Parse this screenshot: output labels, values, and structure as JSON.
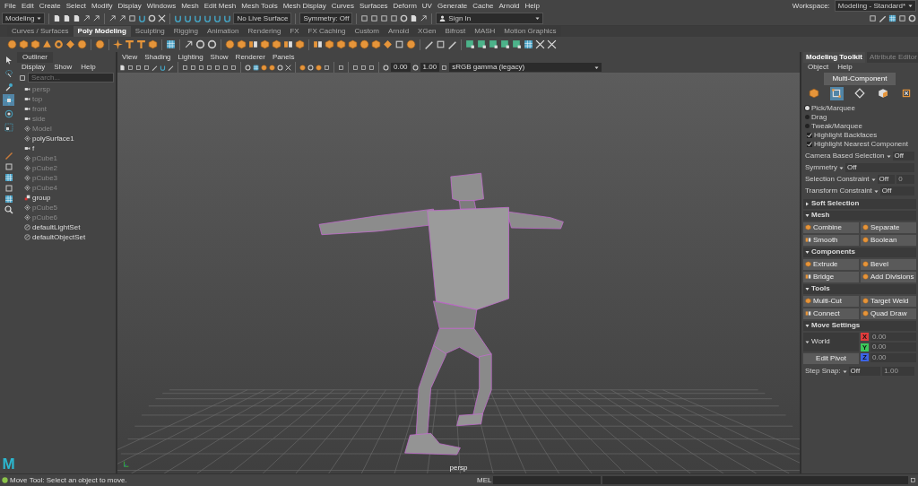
{
  "menu_bar": [
    "File",
    "Edit",
    "Create",
    "Select",
    "Modify",
    "Display",
    "Windows",
    "Mesh",
    "Edit Mesh",
    "Mesh Tools",
    "Mesh Display",
    "Curves",
    "Surfaces",
    "Deform",
    "UV",
    "Generate",
    "Cache",
    "Arnold",
    "Help"
  ],
  "workspace": {
    "label": "Workspace:",
    "value": "Modeling - Standard*"
  },
  "status_line": {
    "mode": "Modeling",
    "live_surface": "No Live Surface",
    "symmetry": "Symmetry: Off",
    "sign_in": "Sign In"
  },
  "shelf_tabs": [
    {
      "label": "Curves / Surfaces",
      "selected": false
    },
    {
      "label": "Poly Modeling",
      "selected": true
    },
    {
      "label": "Sculpting",
      "selected": false
    },
    {
      "label": "Rigging",
      "selected": false
    },
    {
      "label": "Animation",
      "selected": false
    },
    {
      "label": "Rendering",
      "selected": false
    },
    {
      "label": "FX",
      "selected": false
    },
    {
      "label": "FX Caching",
      "selected": false
    },
    {
      "label": "Custom",
      "selected": false
    },
    {
      "label": "Arnold",
      "selected": false
    },
    {
      "label": "XGen",
      "selected": false
    },
    {
      "label": "Bifrost",
      "selected": false
    },
    {
      "label": "MASH",
      "selected": false
    },
    {
      "label": "Motion Graphics",
      "selected": false
    }
  ],
  "toolbox": [
    {
      "kind": "select",
      "selected": false
    },
    {
      "kind": "lasso",
      "selected": false
    },
    {
      "kind": "paint",
      "selected": false
    },
    {
      "kind": "move",
      "selected": true
    },
    {
      "kind": "rotate",
      "selected": false
    },
    {
      "kind": "scale",
      "selected": false
    },
    {
      "kind": "last",
      "selected": false
    }
  ],
  "logo": "M",
  "outliner": {
    "title": "Outliner",
    "menu": [
      "Display",
      "Show",
      "Help"
    ],
    "search_placeholder": "Search...",
    "items": [
      {
        "label": "persp",
        "kind": "camera",
        "hidden": true
      },
      {
        "label": "top",
        "kind": "camera",
        "hidden": true
      },
      {
        "label": "front",
        "kind": "camera",
        "hidden": true
      },
      {
        "label": "side",
        "kind": "camera",
        "hidden": true
      },
      {
        "label": "Model",
        "kind": "transform",
        "hidden": true
      },
      {
        "label": "polySurface1",
        "kind": "transform",
        "hidden": false
      },
      {
        "label": "f",
        "kind": "camera",
        "hidden": false
      },
      {
        "label": "pCube1",
        "kind": "transform",
        "hidden": true
      },
      {
        "label": "pCube2",
        "kind": "transform",
        "hidden": true
      },
      {
        "label": "pCube3",
        "kind": "transform",
        "hidden": true
      },
      {
        "label": "pCube4",
        "kind": "transform",
        "hidden": true
      },
      {
        "label": "group",
        "kind": "group",
        "hidden": false
      },
      {
        "label": "pCube5",
        "kind": "transform",
        "hidden": true
      },
      {
        "label": "pCube6",
        "kind": "transform",
        "hidden": true
      },
      {
        "label": "defaultLightSet",
        "kind": "set",
        "hidden": false
      },
      {
        "label": "defaultObjectSet",
        "kind": "set",
        "hidden": false
      }
    ]
  },
  "viewport": {
    "menu": [
      "View",
      "Shading",
      "Lighting",
      "Show",
      "Renderer",
      "Panels"
    ],
    "exposure": "0.00",
    "gamma": "1.00",
    "color_space": "sRGB gamma (legacy)",
    "camera_label": "persp"
  },
  "toolkit": {
    "tabs": [
      {
        "label": "Modeling Toolkit",
        "selected": true
      },
      {
        "label": "Attribute Editor",
        "selected": false
      }
    ],
    "menu": [
      "Object",
      "Help"
    ],
    "multi_component": "Multi-Component",
    "components": [
      {
        "kind": "object",
        "selected": false
      },
      {
        "kind": "vertex",
        "selected": true
      },
      {
        "kind": "edge",
        "selected": false
      },
      {
        "kind": "face",
        "selected": false
      },
      {
        "kind": "uv",
        "selected": false
      }
    ],
    "selection_modes": [
      {
        "label": "Pick/Marquee",
        "selected": true
      },
      {
        "label": "Drag",
        "selected": false
      },
      {
        "label": "Tweak/Marquee",
        "selected": false
      }
    ],
    "options": [
      {
        "label": "Highlight Backfaces",
        "checked": true
      },
      {
        "label": "Highlight Nearest Component",
        "checked": true
      }
    ],
    "settings": [
      {
        "label": "Camera Based Selection",
        "value": "Off"
      },
      {
        "label": "Symmetry",
        "value": "Off"
      },
      {
        "label": "Selection Constraint",
        "value": "Off",
        "extra": "0"
      },
      {
        "label": "Transform Constraint",
        "value": "Off"
      }
    ],
    "sections": [
      {
        "title": "Soft Selection",
        "expanded": false
      },
      {
        "title": "Mesh",
        "expanded": true,
        "buttons": [
          "Combine",
          "Separate",
          "Smooth",
          "Boolean"
        ]
      },
      {
        "title": "Components",
        "expanded": true,
        "buttons": [
          "Extrude",
          "Bevel",
          "Bridge",
          "Add Divisions"
        ]
      },
      {
        "title": "Tools",
        "expanded": true,
        "buttons": [
          "Multi-Cut",
          "Target Weld",
          "Connect",
          "Quad Draw"
        ]
      }
    ],
    "move_settings": {
      "title": "Move Settings",
      "expanded": true,
      "space": "World",
      "axes": [
        {
          "axis": "X",
          "value": "0.00",
          "color": "#e03c3c"
        },
        {
          "axis": "Y",
          "value": "0.00",
          "color": "#3cc85a"
        },
        {
          "axis": "Z",
          "value": "0.00",
          "color": "#3c64e6"
        }
      ],
      "edit_pivot": "Edit Pivot",
      "step_snap_label": "Step Snap:",
      "step_snap": "Off",
      "step_value": "1.00"
    }
  },
  "command_line": {
    "message": "Move Tool: Select an object to move.",
    "language": "MEL"
  }
}
